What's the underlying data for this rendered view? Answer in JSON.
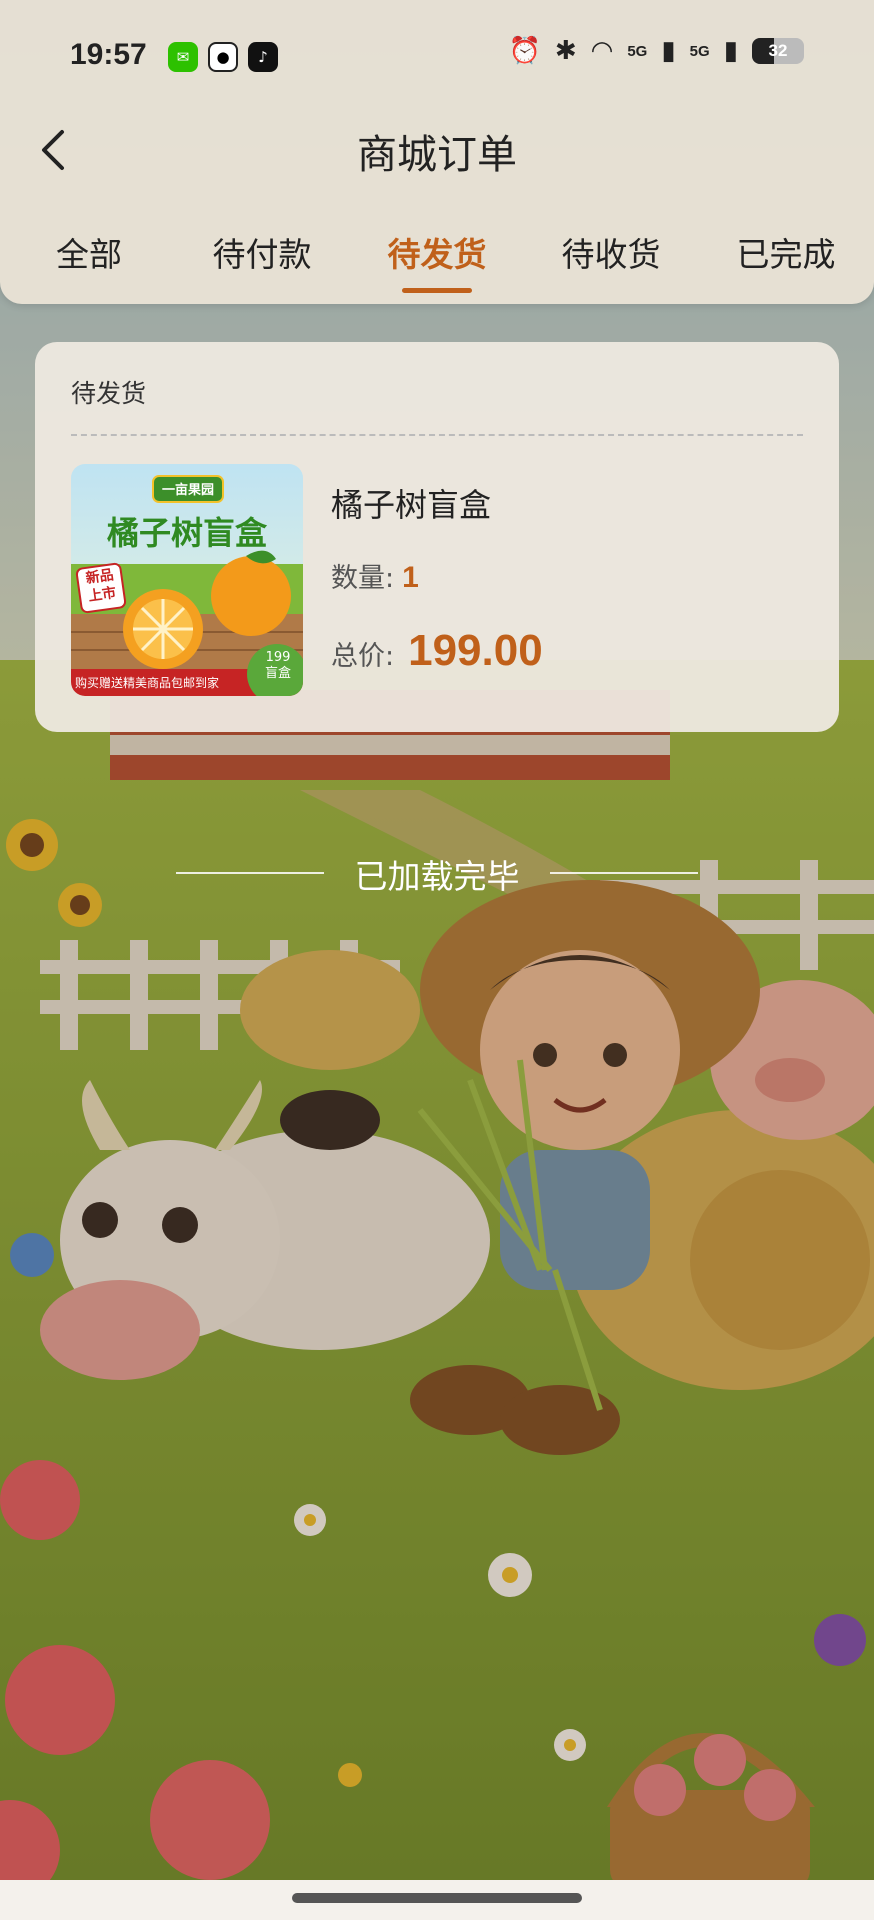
{
  "status_bar": {
    "time": "19:57",
    "apps": [
      "wechat-icon",
      "qq-icon",
      "tiktok-icon"
    ],
    "signal_1": "5G",
    "signal_2": "5G",
    "battery": "32"
  },
  "header": {
    "title": "商城订单",
    "back_icon": "chevron-left-icon"
  },
  "tabs": [
    {
      "label": "全部",
      "active": false
    },
    {
      "label": "待付款",
      "active": false
    },
    {
      "label": "待发货",
      "active": true
    },
    {
      "label": "待收货",
      "active": false
    },
    {
      "label": "已完成",
      "active": false
    }
  ],
  "order": {
    "status": "待发货",
    "product": {
      "name": "橘子树盲盒",
      "image": {
        "badge": "一亩果园",
        "title": "橘子树盲盒",
        "sticker": "新品上市",
        "banner": "购买赠送精美商品包邮到家",
        "corner_price": "199",
        "corner_label": "盲盒"
      }
    },
    "quantity_label": "数量:",
    "quantity": "1",
    "total_label": "总价:",
    "total": "199.00"
  },
  "footer": {
    "end_text": "已加载完毕"
  },
  "colors": {
    "accent": "#c0601a",
    "header_bg": "#ece4d6"
  }
}
